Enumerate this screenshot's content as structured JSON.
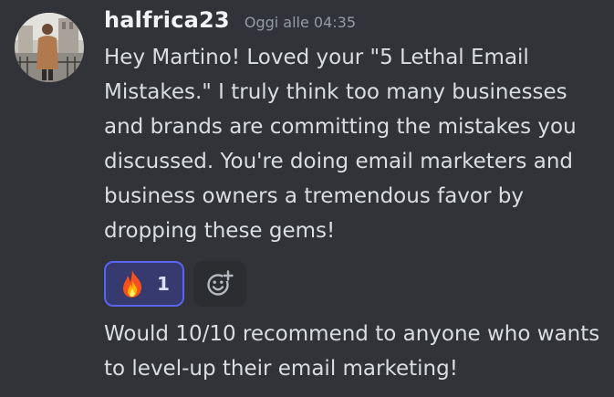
{
  "message": {
    "author": "halfrica23",
    "timestamp": "Oggi alle 04:35",
    "avatar_icon": "user-avatar-photo",
    "content": "Hey Martino! Loved your \"5 Lethal Email Mistakes.\" I truly think too many businesses and brands are committing the mistakes you discussed. You're doing email marketers and business owners a tremendous favor by dropping these gems!",
    "reactions": [
      {
        "emoji": "fire-emoji",
        "count": "1",
        "reacted_by_me": true
      }
    ],
    "add_reaction_icon": "add-reaction-smiley-icon"
  },
  "followup": {
    "content": "Would 10/10 recommend to anyone who wants to level-up their email marketing!"
  },
  "colors": {
    "background": "#313338",
    "username": "#f2f3f5",
    "text": "#dbdee1",
    "timestamp": "#949ba4",
    "reaction_border": "#5865f2",
    "reaction_bg": "#373a6f",
    "add_reaction_bg": "#2b2d31"
  }
}
